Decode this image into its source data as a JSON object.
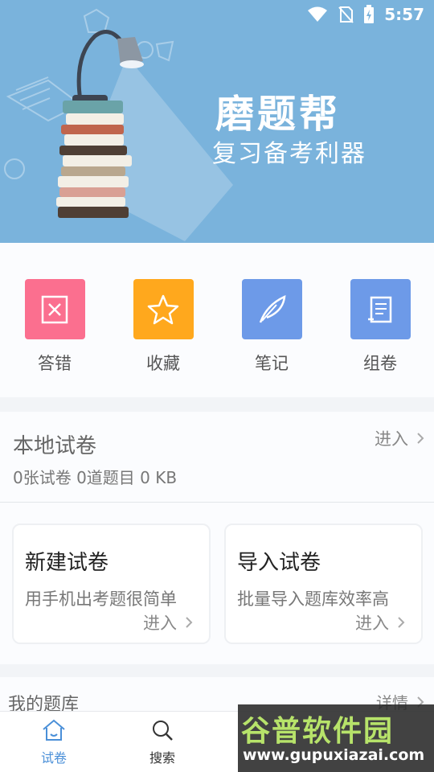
{
  "status_bar": {
    "time": "5:57"
  },
  "banner": {
    "title": "磨题帮",
    "subtitle": "复习备考利器"
  },
  "quick_actions": [
    {
      "label": "答错",
      "icon": "wrong-answer-icon",
      "color": "#fb6f8f"
    },
    {
      "label": "收藏",
      "icon": "star-icon",
      "color": "#ffa81d"
    },
    {
      "label": "笔记",
      "icon": "feather-pen-icon",
      "color": "#6d9ae8"
    },
    {
      "label": "组卷",
      "icon": "scroll-icon",
      "color": "#6d9ae8"
    }
  ],
  "local_papers": {
    "title": "本地试卷",
    "enter": "进入",
    "stats": "0张试卷 0道题目 0 KB"
  },
  "cards": [
    {
      "title": "新建试卷",
      "desc": "用手机出考题很简单",
      "enter": "进入"
    },
    {
      "title": "导入试卷",
      "desc": "批量导入题库效率高",
      "enter": "进入"
    }
  ],
  "my_bank": {
    "title": "我的题库",
    "more": "详情"
  },
  "bottom_nav": [
    {
      "label": "试卷",
      "icon": "home-icon",
      "active": true,
      "color": "#4a8fd8"
    },
    {
      "label": "搜索",
      "icon": "search-icon",
      "active": false,
      "color": "#333333"
    }
  ],
  "watermark": {
    "title": "谷普软件园",
    "url": "www.gupuxiazai.com"
  }
}
